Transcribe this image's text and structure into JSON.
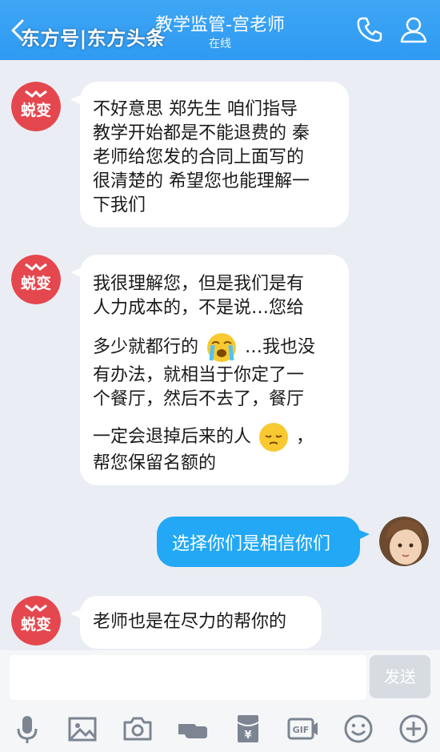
{
  "header": {
    "title": "教学监管-宫老师",
    "status": "在线",
    "watermark": "东方号|东方头条"
  },
  "brand": {
    "avatar_text": "蜕变",
    "avatar_color": "#e5474e"
  },
  "messages": [
    {
      "sender": "teacher",
      "lines": [
        "不好意思 郑先生 咱们指导",
        "教学开始都是不能退费的 秦",
        "老师给您发的合同上面写的",
        "很清楚的 希望您也能理解一",
        "下我们"
      ]
    },
    {
      "sender": "teacher",
      "lines": [
        "我很理解您，但是我们是有",
        "人力成本的，不是说…您给",
        "多少就都行的",
        "…我也没",
        "有办法，就相当于你定了一",
        "个餐厅，然后不去了，餐厅",
        "一定会退掉后来的人",
        "，",
        "帮您保留名额的"
      ]
    },
    {
      "sender": "me",
      "text": "选择你们是相信你们"
    },
    {
      "sender": "teacher",
      "lines": [
        "老师也是在尽力的帮你的"
      ]
    }
  ],
  "input": {
    "placeholder": "",
    "send_label": "发送"
  },
  "toolbar": [
    "mic-icon",
    "image-icon",
    "camera-icon",
    "poke-icon",
    "red-packet-icon",
    "gif-icon",
    "emoji-icon",
    "plus-icon"
  ],
  "colors": {
    "header": "#2f9af2",
    "outgoing_bubble": "#22a8f5",
    "background": "#eaedf3"
  }
}
